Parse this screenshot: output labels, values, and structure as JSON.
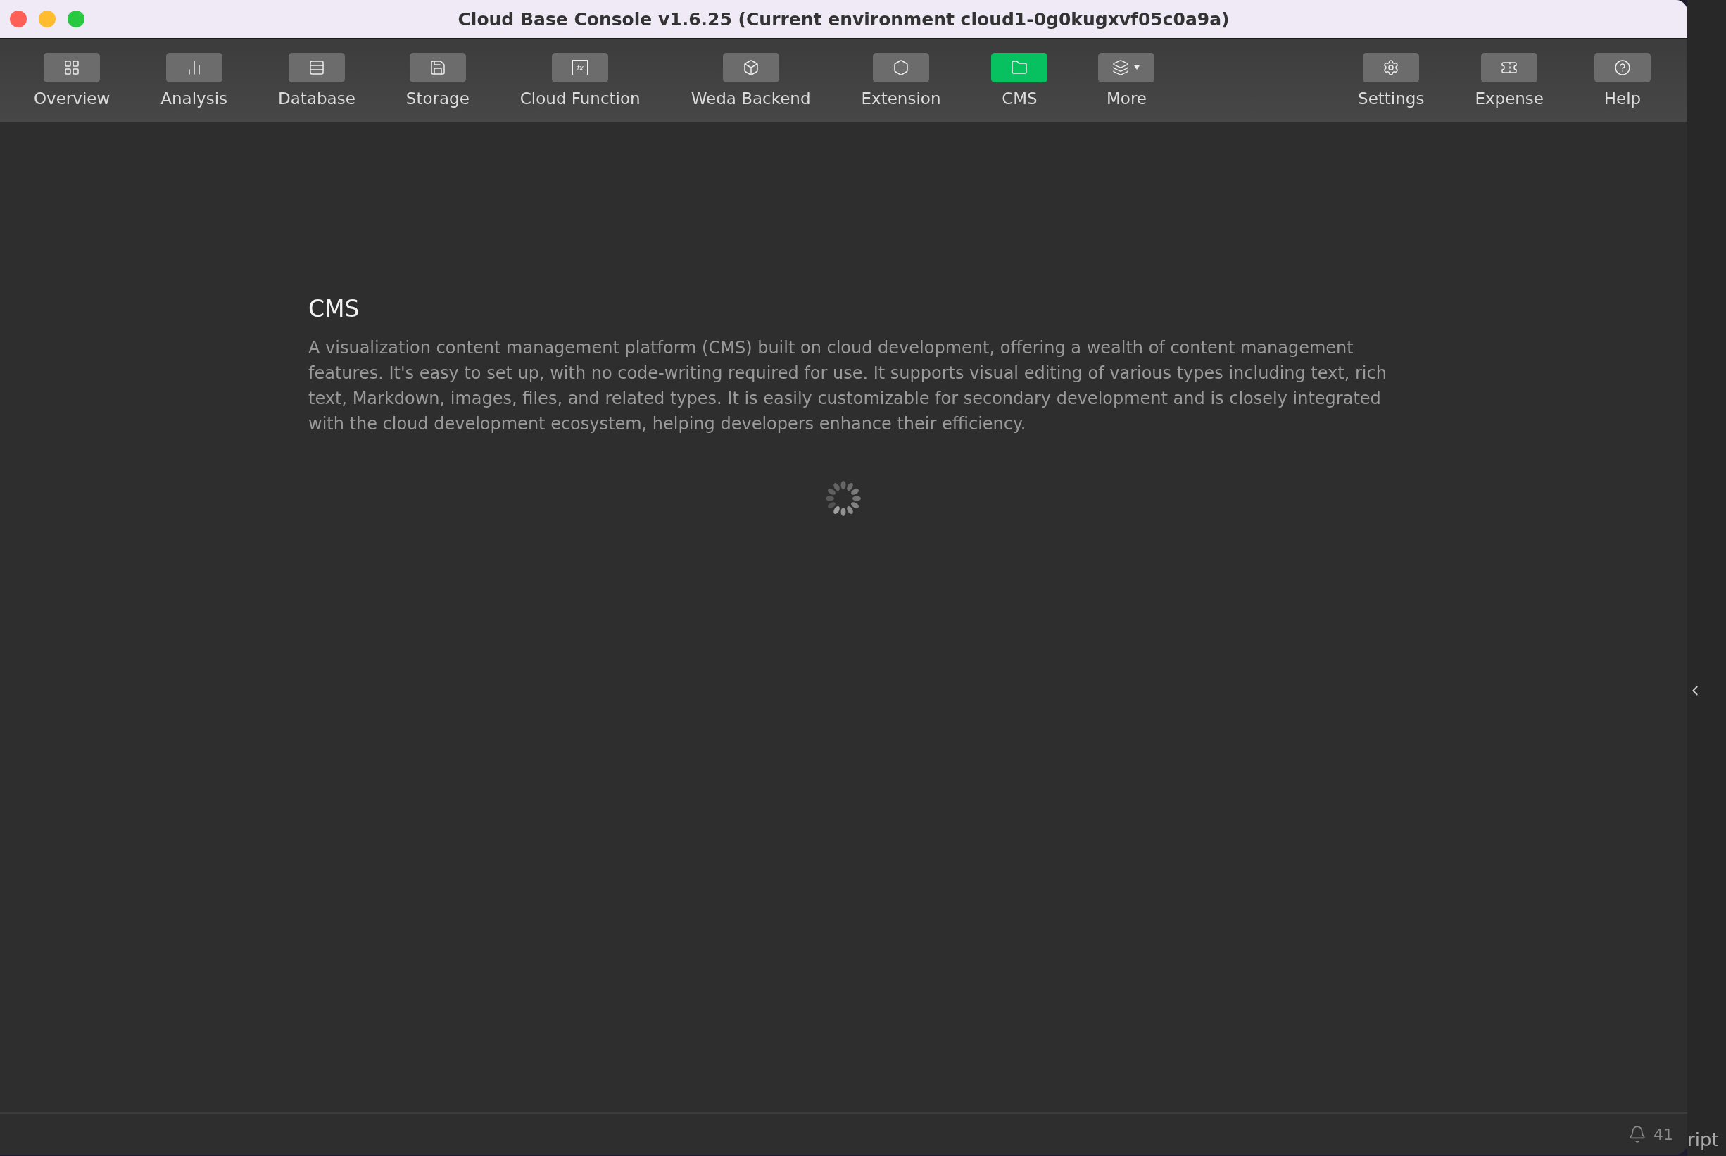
{
  "window": {
    "title": "Cloud Base Console v1.6.25 (Current environment cloud1-0g0kugxvf05c0a9a)"
  },
  "toolbar": {
    "left": [
      {
        "label": "Overview",
        "selected": false
      },
      {
        "label": "Analysis",
        "selected": false
      },
      {
        "label": "Database",
        "selected": false
      },
      {
        "label": "Storage",
        "selected": false
      },
      {
        "label": "Cloud Function",
        "selected": false,
        "icon_text": "fx"
      },
      {
        "label": "Weda Backend",
        "selected": false
      },
      {
        "label": "Extension",
        "selected": false
      },
      {
        "label": "CMS",
        "selected": true
      },
      {
        "label": "More",
        "selected": false,
        "dropdown": true
      }
    ],
    "right": [
      {
        "label": "Settings",
        "selected": false
      },
      {
        "label": "Expense",
        "selected": false
      },
      {
        "label": "Help",
        "selected": false
      }
    ]
  },
  "content": {
    "title": "CMS",
    "description": "A visualization content management platform (CMS) built on cloud development, offering a wealth of content management features. It's easy to set up, with no code-writing required for use. It supports visual editing of various types including text, rich text, Markdown, images, files, and related types. It is easily customizable for secondary development and is closely integrated with the cloud development ecosystem, helping developers enhance their efficiency.",
    "loading": true
  },
  "status_bar": {
    "notifications": "41"
  },
  "background_window": {
    "text": "ript"
  }
}
